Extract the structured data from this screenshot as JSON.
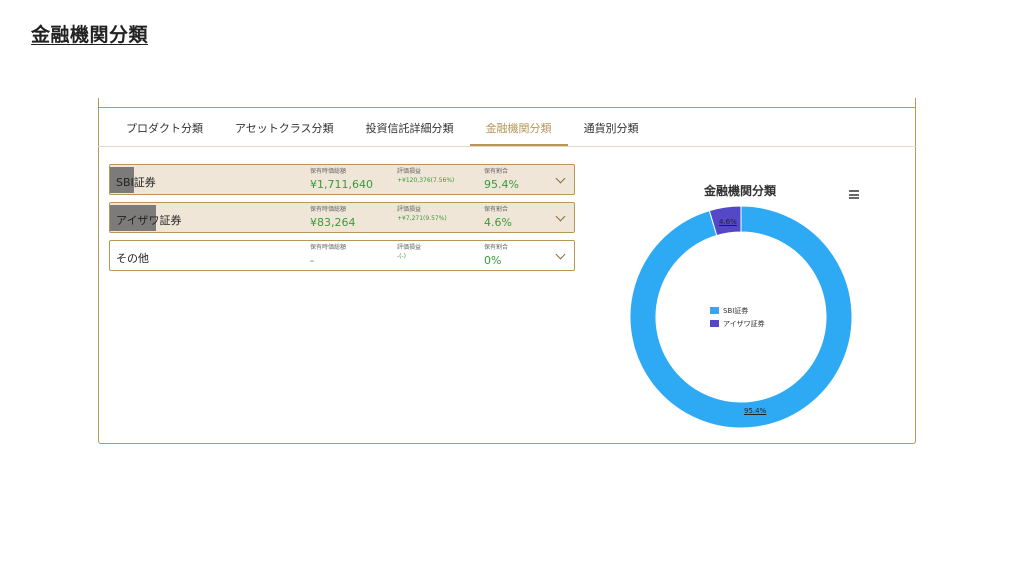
{
  "page": {
    "title": "金融機関分類"
  },
  "tabs": [
    {
      "label": "プロダクト分類"
    },
    {
      "label": "アセットクラス分類"
    },
    {
      "label": "投資信託詳細分類"
    },
    {
      "label": "金融機関分類"
    },
    {
      "label": "通貨別分類"
    }
  ],
  "active_tab": "金融機関分類",
  "column_labels": {
    "market_value": "保有時価総額",
    "pnl": "評価損益",
    "ratio": "保有割合"
  },
  "rows": [
    {
      "name": "SBI証券",
      "market_value": "¥1,711,640",
      "pnl": "+¥120,376(7.56%)",
      "ratio": "95.4%"
    },
    {
      "name": "アイザワ証券",
      "market_value": "¥83,264",
      "pnl": "+¥7,271(9.57%)",
      "ratio": "4.6%"
    },
    {
      "name": "その他",
      "market_value": "-",
      "pnl": "-(-)",
      "ratio": "0%"
    }
  ],
  "chart": {
    "title": "金融機関分類",
    "legend": [
      "SBI証券",
      "アイザワ証券"
    ],
    "slice_labels": [
      "95.4%",
      "4.6%"
    ],
    "colors": {
      "sbi": "#2eaaf5",
      "aizawa": "#5548c8",
      "accent": "#b8965a",
      "positive": "#3b9a3b"
    }
  },
  "chart_data": {
    "type": "pie",
    "title": "金融機関分類",
    "categories": [
      "SBI証券",
      "アイザワ証券"
    ],
    "values": [
      95.4,
      4.6
    ],
    "legend_position": "center"
  },
  "icons": {
    "row_toggle": "chevron-down-icon",
    "chart_menu": "hamburger-menu-icon"
  }
}
